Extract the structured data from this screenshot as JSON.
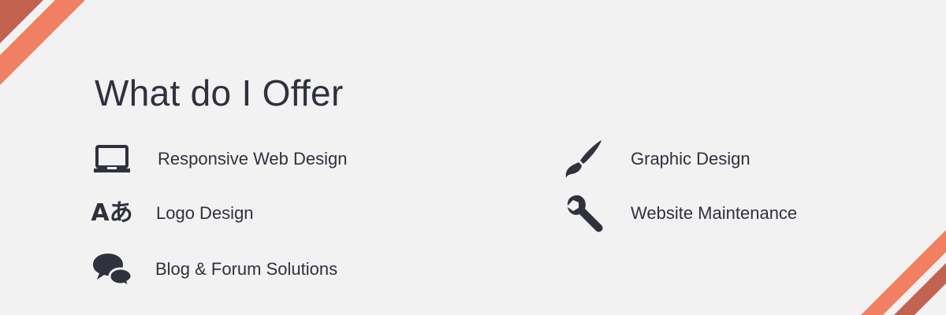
{
  "heading": "What do I Offer",
  "colors": {
    "background": "#f2f2f2",
    "text": "#2f313d",
    "stripe_light": "#f17f62",
    "stripe_dark": "#c1634f"
  },
  "services": {
    "responsive_web_design": {
      "label": "Responsive Web Design",
      "icon": "laptop-icon"
    },
    "logo_design": {
      "label": "Logo Design",
      "icon": "translate-icon",
      "icon_text": "Aあ"
    },
    "blog_forum_solutions": {
      "label": "Blog & Forum Solutions",
      "icon": "chat-bubbles-icon"
    },
    "graphic_design": {
      "label": "Graphic Design",
      "icon": "paintbrush-icon"
    },
    "website_maintenance": {
      "label": "Website Maintenance",
      "icon": "wrench-icon"
    }
  }
}
